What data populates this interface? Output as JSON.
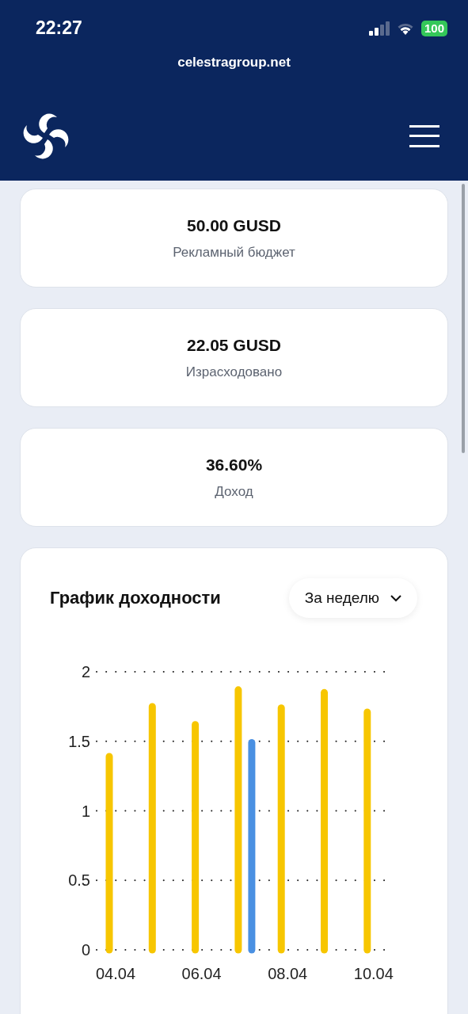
{
  "status_bar": {
    "time": "22:27",
    "battery": "100"
  },
  "browser": {
    "url": "celestragroup.net"
  },
  "stats": [
    {
      "value": "50.00 GUSD",
      "label": "Рекламный бюджет"
    },
    {
      "value": "22.05 GUSD",
      "label": "Израсходовано"
    },
    {
      "value": "36.60%",
      "label": "Доход"
    }
  ],
  "chart_card": {
    "title": "График доходности",
    "period": "За неделю",
    "chart_data": {
      "type": "bar",
      "categories": [
        "04.04",
        null,
        "06.04",
        null,
        "08.04",
        null,
        "10.04"
      ],
      "grid": true,
      "ylim": [
        0,
        2
      ],
      "yticks": [
        0,
        0.5,
        1,
        1.5,
        2
      ],
      "series": [
        {
          "color": "#f7c600",
          "values": [
            1.39,
            1.75,
            1.62,
            1.87,
            1.74,
            1.85,
            1.71
          ]
        },
        {
          "color": "#4a90e2",
          "values": [
            null,
            null,
            null,
            1.49,
            null,
            null,
            null
          ]
        }
      ]
    }
  }
}
